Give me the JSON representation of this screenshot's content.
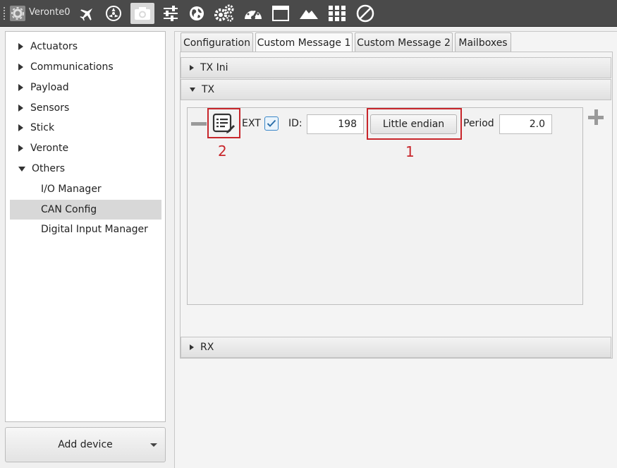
{
  "toolbar": {
    "device_name": "Veronte0",
    "icons": [
      "gear-icon",
      "airplane-icon",
      "radiation-icon",
      "camera-icon",
      "sliders-icon",
      "globe-icon",
      "gears-icon",
      "gauge-icon",
      "window-icon",
      "mountain-icon",
      "grid-icon",
      "no-entry-icon"
    ],
    "active_icon": "camera-icon"
  },
  "sidebar": {
    "items": [
      {
        "label": "Actuators",
        "expanded": false
      },
      {
        "label": "Communications",
        "expanded": false
      },
      {
        "label": "Payload",
        "expanded": false
      },
      {
        "label": "Sensors",
        "expanded": false
      },
      {
        "label": "Stick",
        "expanded": false
      },
      {
        "label": "Veronte",
        "expanded": false
      },
      {
        "label": "Others",
        "expanded": true
      }
    ],
    "children": [
      {
        "label": "I/O Manager"
      },
      {
        "label": "CAN Config",
        "selected": true
      },
      {
        "label": "Digital Input Manager"
      }
    ],
    "add_device_label": "Add device"
  },
  "tabs": [
    {
      "label": "Configuration"
    },
    {
      "label": "Custom Message 1",
      "active": true
    },
    {
      "label": "Custom Message 2"
    },
    {
      "label": "Mailboxes"
    }
  ],
  "sections": {
    "tx_ini": "TX Ini",
    "tx": "TX",
    "rx": "RX"
  },
  "message": {
    "ext_label": "EXT",
    "ext_checked": true,
    "id_label": "ID:",
    "id_value": "198",
    "endian_label": "Little endian",
    "period_label": "Period",
    "period_value": "2.0"
  },
  "annotations": {
    "callout_1": "1",
    "callout_2": "2",
    "accent_color": "#c8262b"
  }
}
